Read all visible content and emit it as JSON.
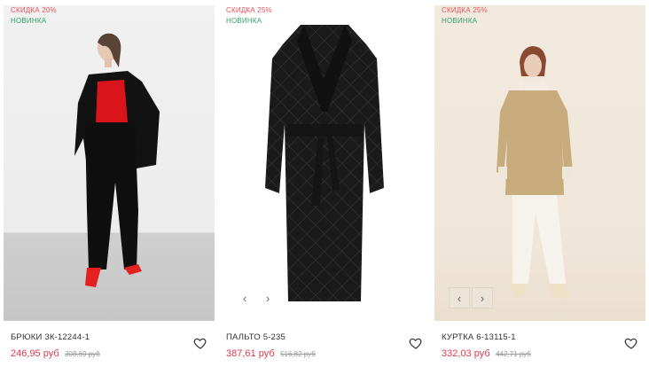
{
  "products": [
    {
      "badge_sale": "СКИДКА 20%",
      "badge_new": "НОВИНКА",
      "title": "БРЮКИ 3К-12244-1",
      "price": "246,95 руб",
      "old_price": "308,69 руб",
      "favorite_icon": "heart-icon"
    },
    {
      "badge_sale": "СКИДКА 25%",
      "badge_new": "НОВИНКА",
      "title": "ПАЛЬТО 5-235",
      "price": "387,61 руб",
      "old_price": "516,82 руб",
      "favorite_icon": "heart-icon",
      "prev_glyph": "‹",
      "next_glyph": "›"
    },
    {
      "badge_sale": "СКИДКА 25%",
      "badge_new": "НОВИНКА",
      "title": "КУРТКА 6-13115-1",
      "price": "332,03 руб",
      "old_price": "442,71 руб",
      "favorite_icon": "heart-icon",
      "prev_glyph": "‹",
      "next_glyph": "›"
    }
  ],
  "colors": {
    "sale": "#e8505b",
    "new": "#33a36a",
    "price": "#e0394f",
    "old_price": "#999999"
  }
}
